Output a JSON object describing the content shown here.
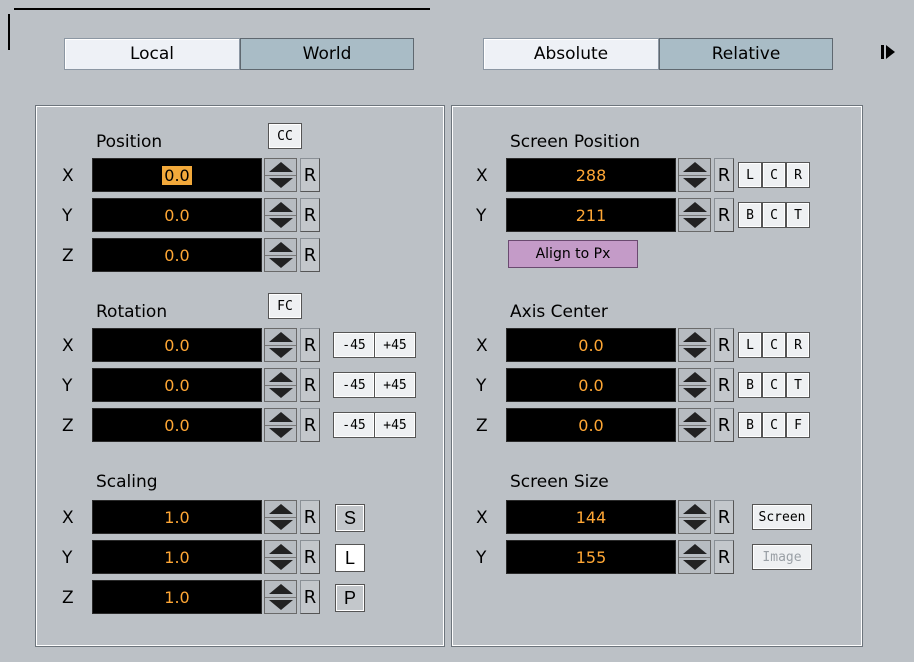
{
  "toggles": {
    "space": [
      "Local",
      "World"
    ],
    "mode": [
      "Absolute",
      "Relative"
    ]
  },
  "left": {
    "position": {
      "title": "Position",
      "mode_button": "CC",
      "rows": [
        {
          "axis": "X",
          "value": "0.0",
          "reset": "R"
        },
        {
          "axis": "Y",
          "value": "0.0",
          "reset": "R"
        },
        {
          "axis": "Z",
          "value": "0.0",
          "reset": "R"
        }
      ]
    },
    "rotation": {
      "title": "Rotation",
      "mode_button": "FC",
      "minus": "-45",
      "plus": "+45",
      "rows": [
        {
          "axis": "X",
          "value": "0.0",
          "reset": "R"
        },
        {
          "axis": "Y",
          "value": "0.0",
          "reset": "R"
        },
        {
          "axis": "Z",
          "value": "0.0",
          "reset": "R"
        }
      ]
    },
    "scaling": {
      "title": "Scaling",
      "rows": [
        {
          "axis": "X",
          "value": "1.0",
          "reset": "R",
          "extra": "S"
        },
        {
          "axis": "Y",
          "value": "1.0",
          "reset": "R",
          "extra": "L"
        },
        {
          "axis": "Z",
          "value": "1.0",
          "reset": "R",
          "extra": "P"
        }
      ]
    }
  },
  "right": {
    "screen_position": {
      "title": "Screen Position",
      "rows": [
        {
          "axis": "X",
          "value": "288",
          "reset": "R",
          "a": "L",
          "b": "C",
          "c": "R"
        },
        {
          "axis": "Y",
          "value": "211",
          "reset": "R",
          "a": "B",
          "b": "C",
          "c": "T"
        }
      ],
      "align_button": "Align to Px"
    },
    "axis_center": {
      "title": "Axis Center",
      "rows": [
        {
          "axis": "X",
          "value": "0.0",
          "reset": "R",
          "a": "L",
          "b": "C",
          "c": "R"
        },
        {
          "axis": "Y",
          "value": "0.0",
          "reset": "R",
          "a": "B",
          "b": "C",
          "c": "T"
        },
        {
          "axis": "Z",
          "value": "0.0",
          "reset": "R",
          "a": "B",
          "b": "C",
          "c": "F"
        }
      ]
    },
    "screen_size": {
      "title": "Screen Size",
      "rows": [
        {
          "axis": "X",
          "value": "144",
          "reset": "R",
          "btn": "Screen"
        },
        {
          "axis": "Y",
          "value": "155",
          "reset": "R",
          "btn": "Image"
        }
      ]
    }
  }
}
